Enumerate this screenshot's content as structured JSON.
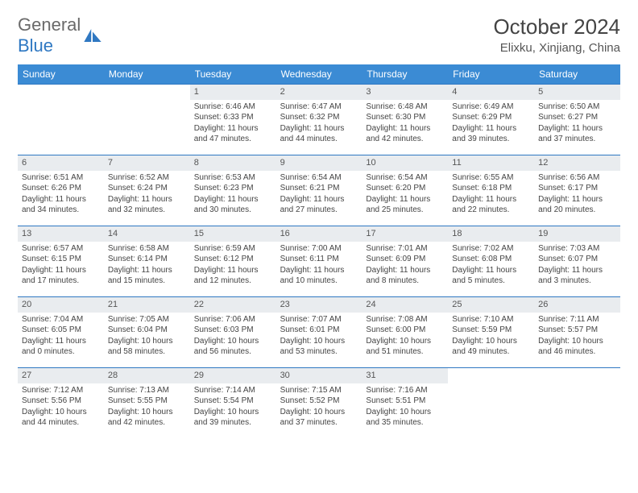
{
  "brand": {
    "part1": "General",
    "part2": "Blue"
  },
  "title": "October 2024",
  "location": "Elixku, Xinjiang, China",
  "dayNames": [
    "Sunday",
    "Monday",
    "Tuesday",
    "Wednesday",
    "Thursday",
    "Friday",
    "Saturday"
  ],
  "startOffset": 2,
  "days": [
    {
      "n": 1,
      "sunrise": "6:46 AM",
      "sunset": "6:33 PM",
      "daylight": "11 hours and 47 minutes."
    },
    {
      "n": 2,
      "sunrise": "6:47 AM",
      "sunset": "6:32 PM",
      "daylight": "11 hours and 44 minutes."
    },
    {
      "n": 3,
      "sunrise": "6:48 AM",
      "sunset": "6:30 PM",
      "daylight": "11 hours and 42 minutes."
    },
    {
      "n": 4,
      "sunrise": "6:49 AM",
      "sunset": "6:29 PM",
      "daylight": "11 hours and 39 minutes."
    },
    {
      "n": 5,
      "sunrise": "6:50 AM",
      "sunset": "6:27 PM",
      "daylight": "11 hours and 37 minutes."
    },
    {
      "n": 6,
      "sunrise": "6:51 AM",
      "sunset": "6:26 PM",
      "daylight": "11 hours and 34 minutes."
    },
    {
      "n": 7,
      "sunrise": "6:52 AM",
      "sunset": "6:24 PM",
      "daylight": "11 hours and 32 minutes."
    },
    {
      "n": 8,
      "sunrise": "6:53 AM",
      "sunset": "6:23 PM",
      "daylight": "11 hours and 30 minutes."
    },
    {
      "n": 9,
      "sunrise": "6:54 AM",
      "sunset": "6:21 PM",
      "daylight": "11 hours and 27 minutes."
    },
    {
      "n": 10,
      "sunrise": "6:54 AM",
      "sunset": "6:20 PM",
      "daylight": "11 hours and 25 minutes."
    },
    {
      "n": 11,
      "sunrise": "6:55 AM",
      "sunset": "6:18 PM",
      "daylight": "11 hours and 22 minutes."
    },
    {
      "n": 12,
      "sunrise": "6:56 AM",
      "sunset": "6:17 PM",
      "daylight": "11 hours and 20 minutes."
    },
    {
      "n": 13,
      "sunrise": "6:57 AM",
      "sunset": "6:15 PM",
      "daylight": "11 hours and 17 minutes."
    },
    {
      "n": 14,
      "sunrise": "6:58 AM",
      "sunset": "6:14 PM",
      "daylight": "11 hours and 15 minutes."
    },
    {
      "n": 15,
      "sunrise": "6:59 AM",
      "sunset": "6:12 PM",
      "daylight": "11 hours and 12 minutes."
    },
    {
      "n": 16,
      "sunrise": "7:00 AM",
      "sunset": "6:11 PM",
      "daylight": "11 hours and 10 minutes."
    },
    {
      "n": 17,
      "sunrise": "7:01 AM",
      "sunset": "6:09 PM",
      "daylight": "11 hours and 8 minutes."
    },
    {
      "n": 18,
      "sunrise": "7:02 AM",
      "sunset": "6:08 PM",
      "daylight": "11 hours and 5 minutes."
    },
    {
      "n": 19,
      "sunrise": "7:03 AM",
      "sunset": "6:07 PM",
      "daylight": "11 hours and 3 minutes."
    },
    {
      "n": 20,
      "sunrise": "7:04 AM",
      "sunset": "6:05 PM",
      "daylight": "11 hours and 0 minutes."
    },
    {
      "n": 21,
      "sunrise": "7:05 AM",
      "sunset": "6:04 PM",
      "daylight": "10 hours and 58 minutes."
    },
    {
      "n": 22,
      "sunrise": "7:06 AM",
      "sunset": "6:03 PM",
      "daylight": "10 hours and 56 minutes."
    },
    {
      "n": 23,
      "sunrise": "7:07 AM",
      "sunset": "6:01 PM",
      "daylight": "10 hours and 53 minutes."
    },
    {
      "n": 24,
      "sunrise": "7:08 AM",
      "sunset": "6:00 PM",
      "daylight": "10 hours and 51 minutes."
    },
    {
      "n": 25,
      "sunrise": "7:10 AM",
      "sunset": "5:59 PM",
      "daylight": "10 hours and 49 minutes."
    },
    {
      "n": 26,
      "sunrise": "7:11 AM",
      "sunset": "5:57 PM",
      "daylight": "10 hours and 46 minutes."
    },
    {
      "n": 27,
      "sunrise": "7:12 AM",
      "sunset": "5:56 PM",
      "daylight": "10 hours and 44 minutes."
    },
    {
      "n": 28,
      "sunrise": "7:13 AM",
      "sunset": "5:55 PM",
      "daylight": "10 hours and 42 minutes."
    },
    {
      "n": 29,
      "sunrise": "7:14 AM",
      "sunset": "5:54 PM",
      "daylight": "10 hours and 39 minutes."
    },
    {
      "n": 30,
      "sunrise": "7:15 AM",
      "sunset": "5:52 PM",
      "daylight": "10 hours and 37 minutes."
    },
    {
      "n": 31,
      "sunrise": "7:16 AM",
      "sunset": "5:51 PM",
      "daylight": "10 hours and 35 minutes."
    }
  ],
  "labels": {
    "sunrise": "Sunrise:",
    "sunset": "Sunset:",
    "daylight": "Daylight:"
  }
}
